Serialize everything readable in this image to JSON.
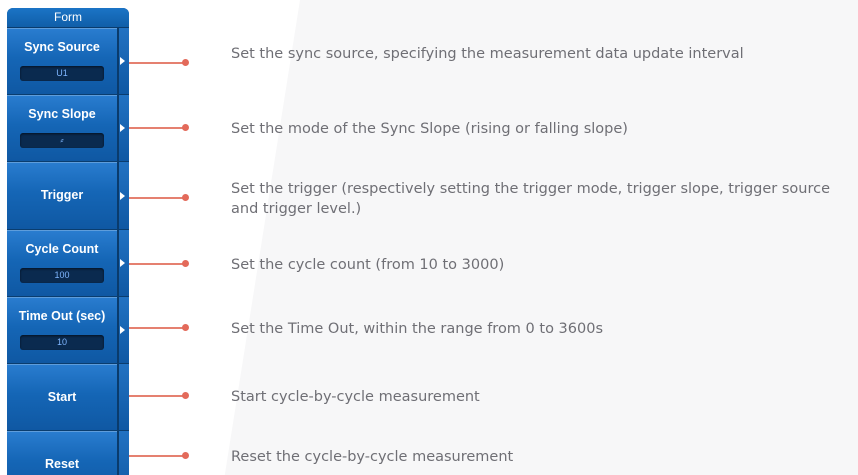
{
  "menu": {
    "title": "Form",
    "keys": [
      {
        "label": "Sync Source",
        "value": "U1",
        "has_submenu": true
      },
      {
        "label": "Sync Slope",
        "value": "⸗",
        "has_submenu": true
      },
      {
        "label": "Trigger",
        "has_submenu": true
      },
      {
        "label": "Cycle Count",
        "value": "100",
        "has_submenu": true
      },
      {
        "label": "Time Out (sec)",
        "value": "10",
        "has_submenu": true
      },
      {
        "label": "Start",
        "has_submenu": false
      },
      {
        "label": "Reset",
        "has_submenu": false
      }
    ]
  },
  "descriptions": [
    "Set the sync source, specifying the measurement data update interval",
    "Set the mode of the Sync Slope (rising or falling slope)",
    "Set the trigger (respectively setting the trigger mode, trigger slope, trigger source and trigger level.)",
    "Set the cycle count (from 10 to 3000)",
    "Set the Time Out, within the range from 0 to 3600s",
    "Start cycle-by-cycle measurement",
    "Reset the cycle-by-cycle measurement"
  ],
  "colors": {
    "menu_blue": "#1566b6",
    "value_field": "#0a2a4f",
    "connector": "#e36a5a",
    "description_text": "#6f6f75"
  }
}
